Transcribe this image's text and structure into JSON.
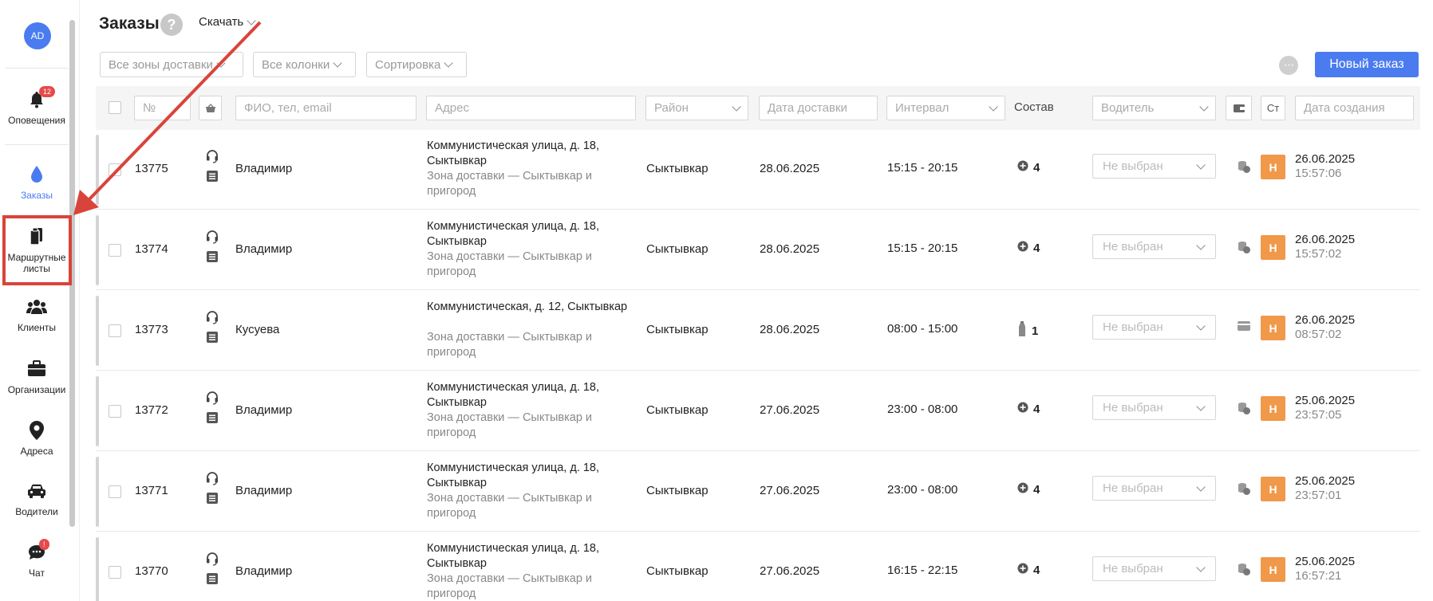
{
  "sidebar": {
    "avatar": "AD",
    "items": [
      {
        "label": "Оповещения",
        "badge": "12",
        "icon": "bell-icon"
      },
      {
        "label": "Заказы",
        "icon": "drop-icon",
        "active": true
      },
      {
        "label": "Маршрутные листы",
        "icon": "clipboard-icon"
      },
      {
        "label": "Клиенты",
        "icon": "users-icon"
      },
      {
        "label": "Организации",
        "icon": "briefcase-icon"
      },
      {
        "label": "Адреса",
        "icon": "map-pin-icon"
      },
      {
        "label": "Водители",
        "icon": "car-icon"
      },
      {
        "label": "Чат",
        "badge": "!",
        "icon": "chat-icon"
      }
    ]
  },
  "header": {
    "title": "Заказы",
    "help": "?",
    "download_label": "Скачать"
  },
  "filters": {
    "zones": "Все зоны доставки",
    "columns": "Все колонки",
    "sort": "Сортировка",
    "more": "···",
    "new_order": "Новый заказ"
  },
  "table_header": {
    "number_placeholder": "№",
    "client_placeholder": "ФИО, тел, email",
    "address_placeholder": "Адрес",
    "district_placeholder": "Район",
    "date_placeholder": "Дата доставки",
    "interval_placeholder": "Интервал",
    "composition_label": "Состав",
    "driver_placeholder": "Водитель",
    "status_label": "Ст",
    "created_placeholder": "Дата создания"
  },
  "accent_color": "#4a7cf0",
  "status_color": "#f0994a",
  "rows": [
    {
      "number": "13775",
      "client": "Владимир",
      "address": "Коммунистическая улица, д. 18, Сыктывкар",
      "zone": "Зона доставки — Сыктывкар и пригород",
      "district": "Сыктывкар",
      "date": "28.06.2025",
      "interval": "15:15 - 20:15",
      "composition": "4",
      "driver": "Не выбран",
      "status": "Н",
      "created_date": "26.06.2025",
      "created_time": "15:57:06",
      "pay_icon": "coins-icon"
    },
    {
      "number": "13774",
      "client": "Владимир",
      "address": "Коммунистическая улица, д. 18, Сыктывкар",
      "zone": "Зона доставки — Сыктывкар и пригород",
      "district": "Сыктывкар",
      "date": "28.06.2025",
      "interval": "15:15 - 20:15",
      "composition": "4",
      "driver": "Не выбран",
      "status": "Н",
      "created_date": "26.06.2025",
      "created_time": "15:57:02",
      "pay_icon": "coins-icon"
    },
    {
      "number": "13773",
      "client": "Кусуева",
      "address": "Коммунистическая, д. 12, Сыктывкар",
      "zone": "Зона доставки — Сыктывкар и пригород",
      "district": "Сыктывкар",
      "date": "28.06.2025",
      "interval": "08:00 - 15:00",
      "composition": "1",
      "driver": "Не выбран",
      "status": "Н",
      "created_date": "26.06.2025",
      "created_time": "08:57:02",
      "pay_icon": "card-icon"
    },
    {
      "number": "13772",
      "client": "Владимир",
      "address": "Коммунистическая улица, д. 18, Сыктывкар",
      "zone": "Зона доставки — Сыктывкар и пригород",
      "district": "Сыктывкар",
      "date": "27.06.2025",
      "interval": "23:00 - 08:00",
      "composition": "4",
      "driver": "Не выбран",
      "status": "Н",
      "created_date": "25.06.2025",
      "created_time": "23:57:05",
      "pay_icon": "coins-icon"
    },
    {
      "number": "13771",
      "client": "Владимир",
      "address": "Коммунистическая улица, д. 18, Сыктывкар",
      "zone": "Зона доставки — Сыктывкар и пригород",
      "district": "Сыктывкар",
      "date": "27.06.2025",
      "interval": "23:00 - 08:00",
      "composition": "4",
      "driver": "Не выбран",
      "status": "Н",
      "created_date": "25.06.2025",
      "created_time": "23:57:01",
      "pay_icon": "coins-icon"
    },
    {
      "number": "13770",
      "client": "Владимир",
      "address": "Коммунистическая улица, д. 18, Сыктывкар",
      "zone": "Зона доставки — Сыктывкар и пригород",
      "district": "Сыктывкар",
      "date": "27.06.2025",
      "interval": "16:15 - 22:15",
      "composition": "4",
      "driver": "Не выбран",
      "status": "Н",
      "created_date": "25.06.2025",
      "created_time": "16:57:21",
      "pay_icon": "coins-icon"
    }
  ]
}
